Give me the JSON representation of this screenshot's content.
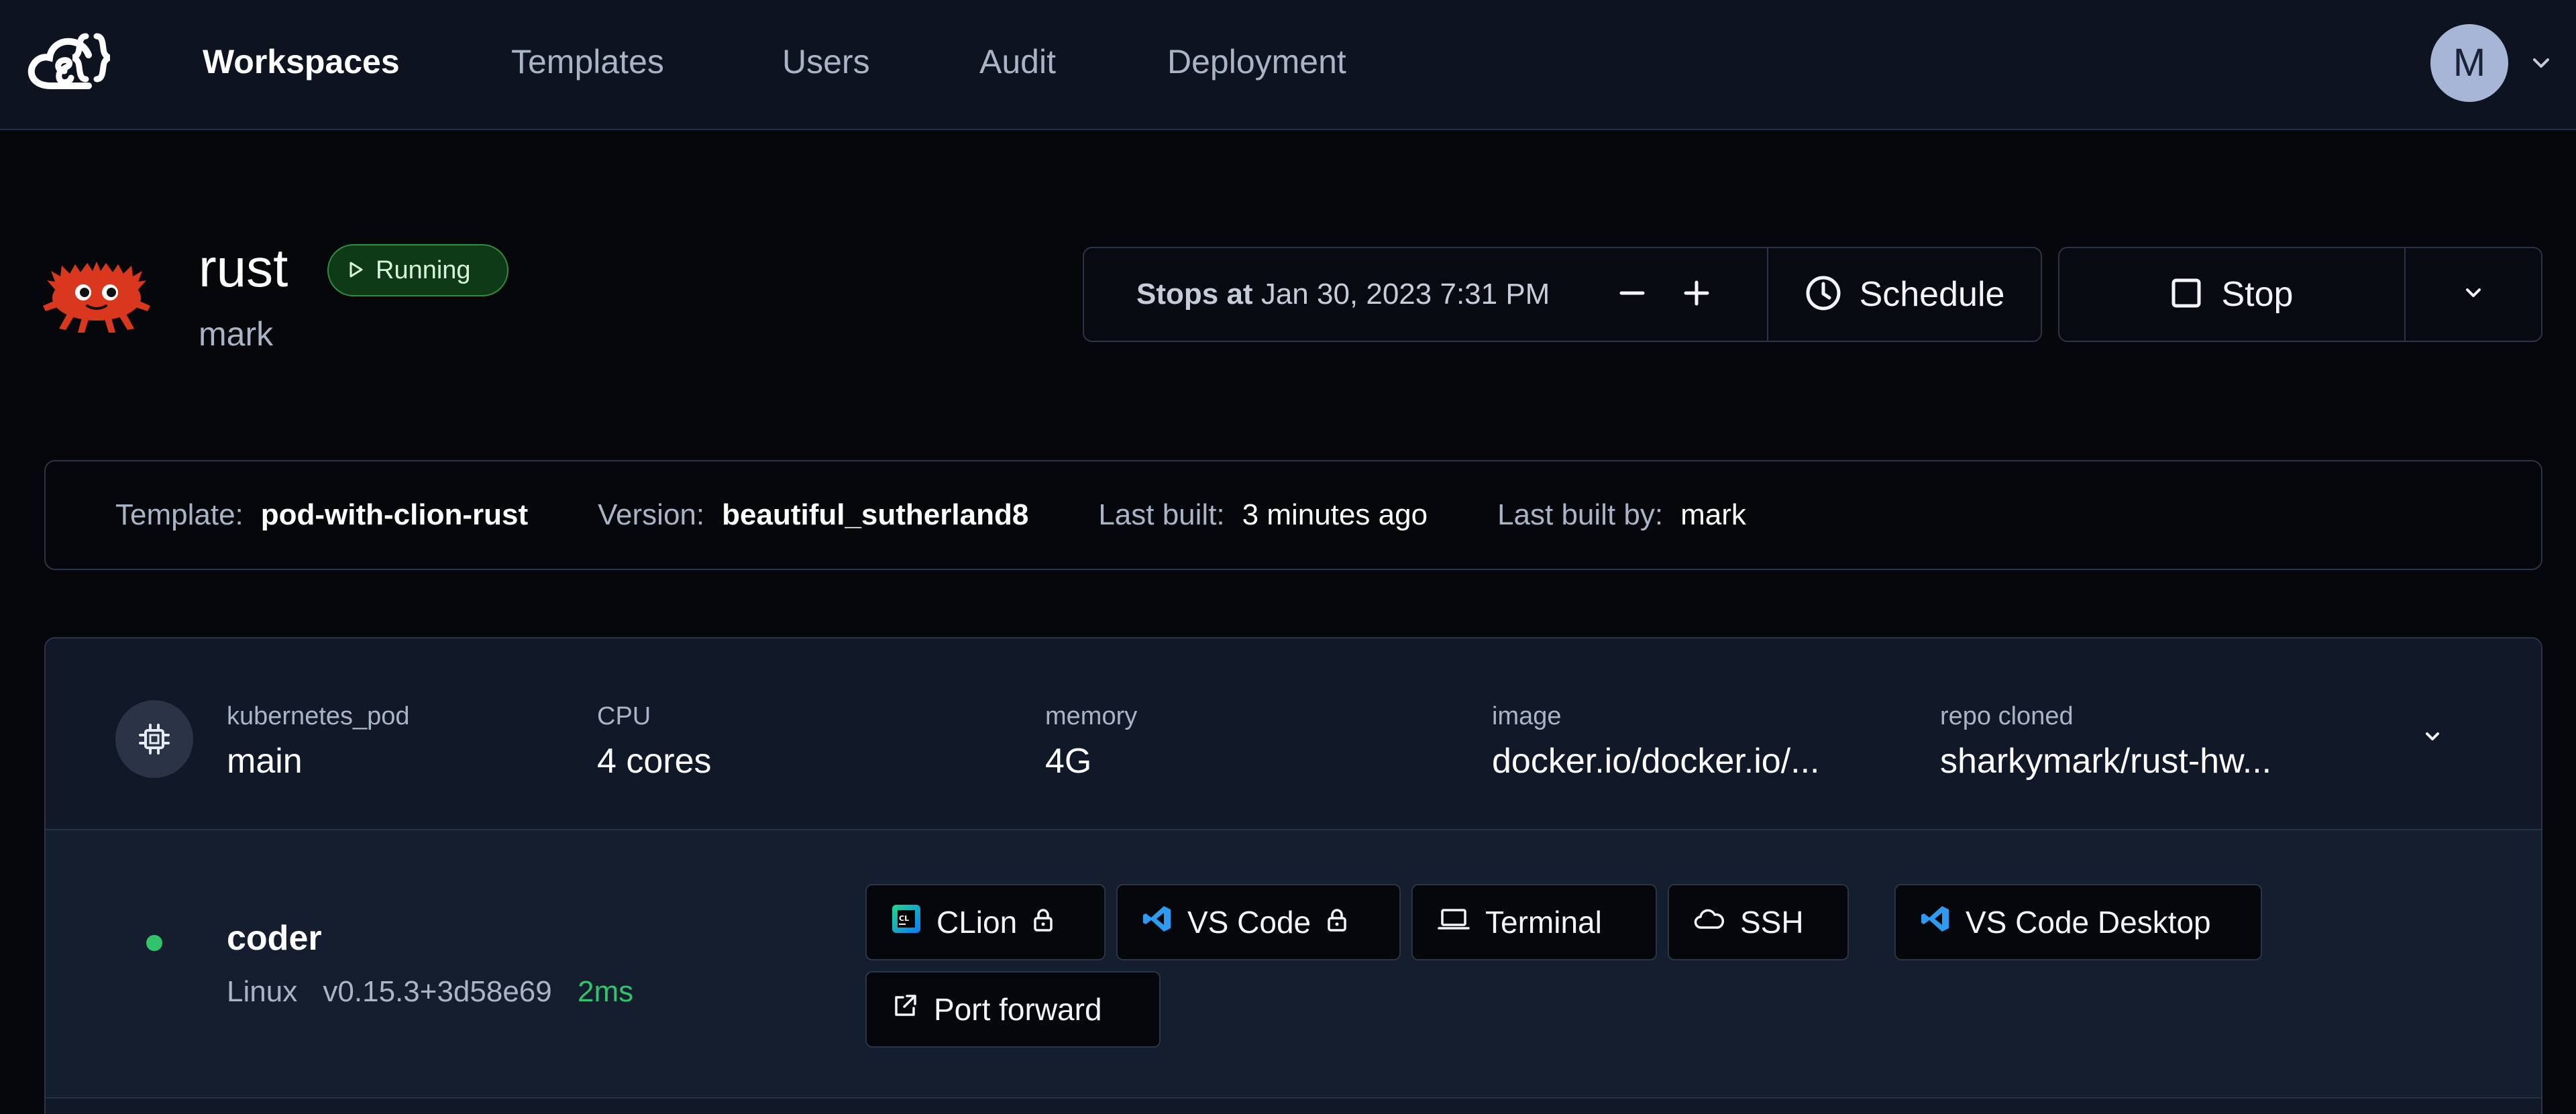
{
  "nav": {
    "items": [
      {
        "label": "Workspaces",
        "active": true
      },
      {
        "label": "Templates",
        "active": false
      },
      {
        "label": "Users",
        "active": false
      },
      {
        "label": "Audit",
        "active": false
      },
      {
        "label": "Deployment",
        "active": false
      }
    ],
    "avatar_initial": "M"
  },
  "workspace": {
    "name": "rust",
    "owner": "mark",
    "status": "Running",
    "stops_at_label": "Stops at",
    "stops_at_value": "Jan 30, 2023 7:31 PM",
    "schedule_label": "Schedule",
    "stop_label": "Stop"
  },
  "template_info": {
    "template_key": "Template:",
    "template_val": "pod-with-clion-rust",
    "version_key": "Version:",
    "version_val": "beautiful_sutherland8",
    "last_built_key": "Last built:",
    "last_built_val": "3 minutes ago",
    "last_built_by_key": "Last built by:",
    "last_built_by_val": "mark"
  },
  "resource": {
    "type": "kubernetes_pod",
    "name": "main",
    "cpu_label": "CPU",
    "cpu_value": "4 cores",
    "memory_label": "memory",
    "memory_value": "4G",
    "image_label": "image",
    "image_value": "docker.io/docker.io/...",
    "repo_label": "repo cloned",
    "repo_value": "sharkymark/rust-hw..."
  },
  "agent": {
    "name": "coder",
    "os": "Linux",
    "version": "v0.15.3+3d58e69",
    "latency": "2ms",
    "status_color": "#33c46b",
    "apps": {
      "clion": "CLion",
      "vscode": "VS Code",
      "terminal": "Terminal",
      "ssh": "SSH",
      "vscode_desktop": "VS Code Desktop",
      "port_forward": "Port forward"
    }
  },
  "colors": {
    "accent_running": "#2f8f3d",
    "background": "#05070b",
    "card": "#111827"
  }
}
